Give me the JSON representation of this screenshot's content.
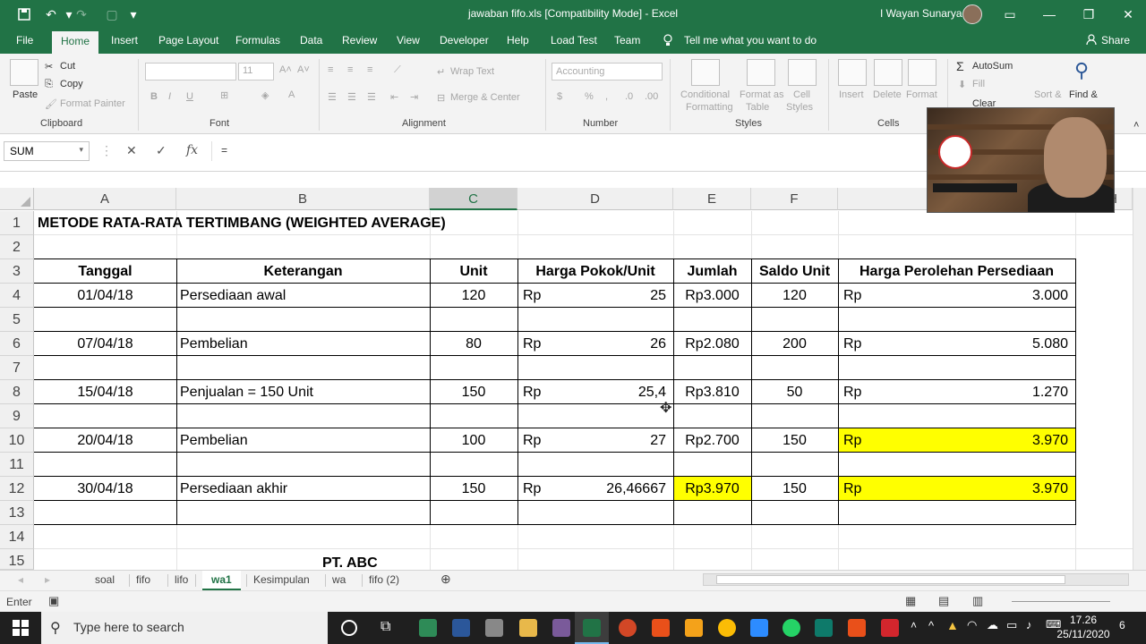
{
  "window": {
    "title": "jawaban fifo.xls  [Compatibility Mode]  -  Excel",
    "user": "I Wayan Sunarya"
  },
  "menu": {
    "tabs": [
      "File",
      "Home",
      "Insert",
      "Page Layout",
      "Formulas",
      "Data",
      "Review",
      "View",
      "Developer",
      "Help",
      "Load Test",
      "Team"
    ],
    "active": "Home",
    "tell_me": "Tell me what you want to do",
    "share": "Share"
  },
  "ribbon": {
    "clipboard": {
      "label": "Clipboard",
      "paste": "Paste",
      "cut": "Cut",
      "copy": "Copy",
      "format_painter": "Format Painter"
    },
    "font": {
      "label": "Font",
      "size": "11",
      "bold": "B",
      "italic": "I",
      "underline": "U"
    },
    "alignment": {
      "label": "Alignment",
      "wrap_text": "Wrap Text",
      "merge_center": "Merge & Center"
    },
    "number": {
      "label": "Number",
      "format": "Accounting"
    },
    "styles": {
      "label": "Styles",
      "conditional": "Conditional",
      "formatting": "Formatting",
      "format_as": "Format as",
      "table": "Table",
      "cell": "Cell",
      "styles": "Styles"
    },
    "cells": {
      "label": "Cells",
      "insert": "Insert",
      "delete": "Delete",
      "format": "Format"
    },
    "editing": {
      "autosum": "AutoSum",
      "fill": "Fill",
      "clear": "Clear",
      "sort": "Sort &",
      "find": "Find &"
    }
  },
  "formula_bar": {
    "name_box": "SUM",
    "content": "="
  },
  "columns": [
    {
      "name": "A"
    },
    {
      "name": "B"
    },
    {
      "name": "C"
    },
    {
      "name": "D"
    },
    {
      "name": "E"
    },
    {
      "name": "F"
    },
    {
      "name": "H"
    }
  ],
  "rows": [
    "1",
    "2",
    "3",
    "4",
    "5",
    "6",
    "7",
    "8",
    "9",
    "10",
    "11",
    "12",
    "13",
    "14",
    "15"
  ],
  "sheet": {
    "title": "METODE RATA-RATA TERTIMBANG (WEIGHTED AVERAGE)",
    "headers": [
      "Tanggal",
      "Keterangan",
      "Unit",
      "Harga Pokok/Unit",
      "Jumlah",
      "Saldo Unit",
      "Harga Perolehan Persediaan"
    ],
    "data_rows": [
      {
        "row": "4",
        "tanggal": "01/04/18",
        "ket": "Persediaan awal",
        "unit": "120",
        "rp": "Rp",
        "harga": "25",
        "jumlah": "Rp3.000",
        "saldo": "120",
        "rp2": "Rp",
        "perolehan": "3.000",
        "hl_jumlah": false,
        "hl_perolehan": false
      },
      {
        "row": "6",
        "tanggal": "07/04/18",
        "ket": "Pembelian",
        "unit": "80",
        "rp": "Rp",
        "harga": "26",
        "jumlah": "Rp2.080",
        "saldo": "200",
        "rp2": "Rp",
        "perolehan": "5.080",
        "hl_jumlah": false,
        "hl_perolehan": false
      },
      {
        "row": "8",
        "tanggal": "15/04/18",
        "ket": "Penjualan = 150 Unit",
        "unit": "150",
        "rp": "Rp",
        "harga": "25,4",
        "jumlah": "Rp3.810",
        "saldo": "50",
        "rp2": "Rp",
        "perolehan": "1.270",
        "hl_jumlah": false,
        "hl_perolehan": false
      },
      {
        "row": "10",
        "tanggal": "20/04/18",
        "ket": "Pembelian",
        "unit": "100",
        "rp": "Rp",
        "harga": "27",
        "jumlah": "Rp2.700",
        "saldo": "150",
        "rp2": "Rp",
        "perolehan": "3.970",
        "hl_jumlah": false,
        "hl_perolehan": true
      },
      {
        "row": "12",
        "tanggal": "30/04/18",
        "ket": "Persediaan akhir",
        "unit": "150",
        "rp": "Rp",
        "harga": "26,46667",
        "jumlah": "Rp3.970",
        "saldo": "150",
        "rp2": "Rp",
        "perolehan": "3.970",
        "hl_jumlah": true,
        "hl_perolehan": true
      }
    ],
    "footer_text": "PT. ABC"
  },
  "sheet_tabs": [
    "soal",
    "fifo",
    "lifo",
    "wa1",
    "Kesimpulan",
    "wa",
    "fifo (2)"
  ],
  "active_sheet": "wa1",
  "status": {
    "mode": "Enter"
  },
  "taskbar": {
    "search_placeholder": "Type here to search",
    "time": "17.26",
    "date": "25/11/2020",
    "notifications": "6"
  },
  "colors": {
    "excel_green": "#217346",
    "highlight": "#ffff00"
  }
}
